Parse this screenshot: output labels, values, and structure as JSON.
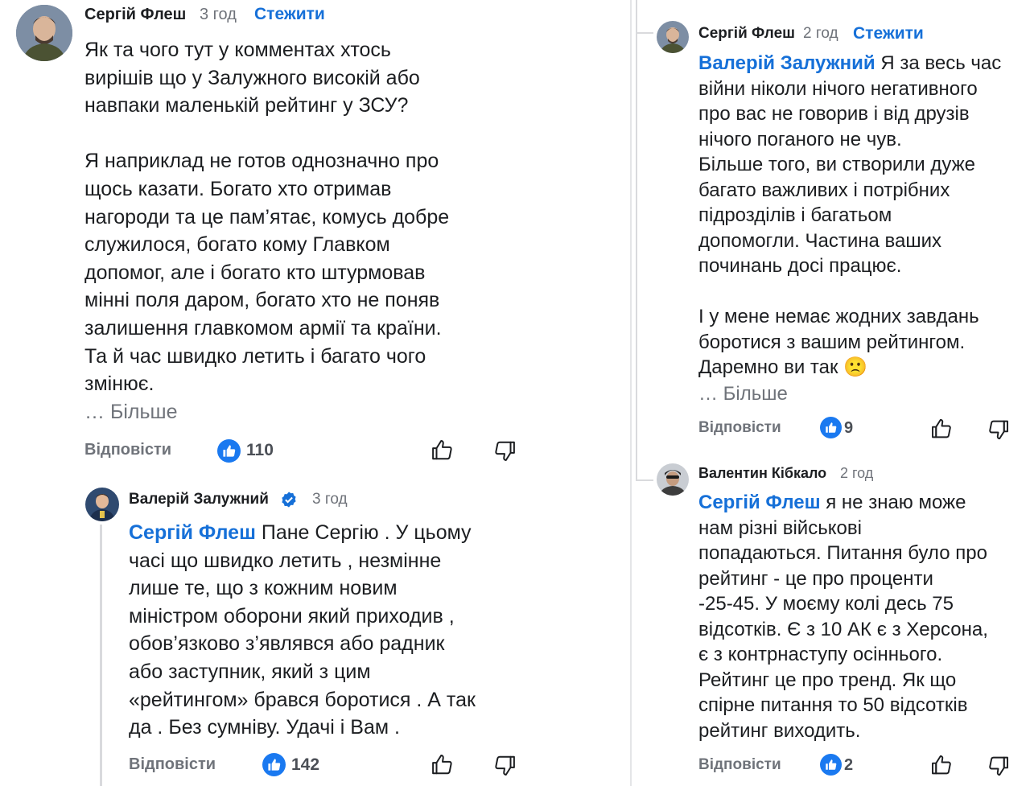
{
  "left": {
    "comment1": {
      "author": "Сергій Флеш",
      "time": "3 год",
      "follow": "Стежити",
      "text": "Як та чого тут у комментах хтось\nвирішів що у Залужного високій або\nнавпаки маленькій рейтинг у ЗСУ?\n\nЯ наприклад не готов однозначно про\nщось казати. Богато хто отримав\nнагороди та це пам’ятає, комусь добре\nслужилося, богато кому Главком\nдопомог, але і богато кто штурмовав\nмінні поля даром, богато хто не поняв\nзалишення главкомом армії та країни.\nТа й час швидко летить і багато чого\nзмінює.",
      "more": "… Більше",
      "reply": "Відповісти",
      "likes": "110"
    },
    "comment2": {
      "author": "Валерій Залужний",
      "time": "3 год",
      "mention": "Сергій Флеш",
      "text_first": " Пане Сергію . У цьому",
      "text_rest": "часі що швидко летить , незмінне\nлише те, що з кожним новим\nміністром оборони який приходив ,\nобов’язково з’являвся або радник\nабо заступник, який з цим\n«рейтингом» брався боротися . А так\nда . Без сумніву. Удачі і Вам .",
      "reply": "Відповісти",
      "likes": "142"
    }
  },
  "right": {
    "comment1": {
      "author": "Сергій Флеш",
      "time": "2 год",
      "follow": "Стежити",
      "mention": "Валерій Залужний",
      "text_first": " Я за весь час",
      "text_rest": "війни ніколи нічого негативного\nпро вас не говорив і від друзів\nнічого поганого не чув.\nБільше того, ви створили дуже\nбагато важливих і потрібних\nпідрозділів і багатьом\nдопомогли. Частина ваших\nпочинань досі працює.\n\nІ у мене немає жодних завдань\nборотися з вашим рейтингом.",
      "last_line": "Даремно ви так",
      "emoji": "🙁",
      "more": "… Більше",
      "reply": "Відповісти",
      "likes": "9"
    },
    "comment2": {
      "author": "Валентин Кібкало",
      "time": "2 год",
      "mention": "Сергій Флеш",
      "text_first": " я не знаю може",
      "text_rest": "нам різні військові\nпопадаються. Питання було про\nрейтинг - це про проценти\n-25-45. У моєму колі десь 75\nвідсотків. Є з 10 АК є з Херсона,\nє з контрнаступу осіннього.\nРейтинг це про тренд. Як що\nспірне питання то 50 відсотків\nрейтинг виходить.",
      "reply": "Відповісти",
      "likes": "2"
    }
  },
  "colors": {
    "accent": "#1670d8",
    "like_badge": "#1a79f0",
    "muted": "#6f737a"
  }
}
